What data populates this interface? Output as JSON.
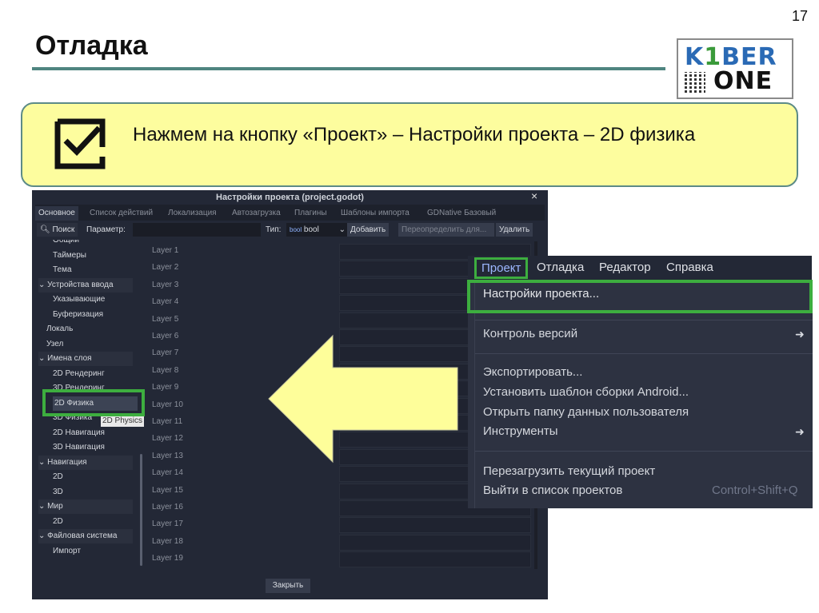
{
  "slide": {
    "title": "Отладка",
    "page_number": "17",
    "logo": {
      "line1_a": "K",
      "line1_b": "1",
      "line1_c": "BER",
      "line2": "ONE"
    },
    "instruction": "Нажмем на кнопку «Проект» – Настройки проекта – 2D физика"
  },
  "dialog": {
    "title": "Настройки проекта (project.godot)",
    "close_glyph": "×",
    "tabs": [
      "Основное",
      "Список действий",
      "Локализация",
      "Автозагрузка",
      "Плагины",
      "Шаблоны импорта",
      "GDNative Базовый"
    ],
    "toolbar": {
      "search": "Поиск",
      "param_label": "Параметр:",
      "type_label": "Тип:",
      "type_value": "bool",
      "add": "Добавить",
      "override": "Переопределить для...",
      "delete": "Удалить"
    },
    "tree": [
      {
        "label": "Общий",
        "indent": 1
      },
      {
        "label": "Таймеры",
        "indent": 1
      },
      {
        "label": "Тема",
        "indent": 1
      },
      {
        "label": "Устройства ввода",
        "indent": 0,
        "category": true
      },
      {
        "label": "Указывающие",
        "indent": 1
      },
      {
        "label": "Буферизация",
        "indent": 1
      },
      {
        "label": "Локаль",
        "indent": 0
      },
      {
        "label": "Узел",
        "indent": 0
      },
      {
        "label": "Имена слоя",
        "indent": 0,
        "category": true
      },
      {
        "label": "2D Рендеринг",
        "indent": 1
      },
      {
        "label": "3D Рендеринг",
        "indent": 1
      },
      {
        "label": "2D Физика",
        "indent": 1,
        "selected": true
      },
      {
        "label": "3D Физика",
        "indent": 1
      },
      {
        "label": "2D Навигация",
        "indent": 1
      },
      {
        "label": "3D Навигация",
        "indent": 1
      },
      {
        "label": "Навигация",
        "indent": 0,
        "category": true
      },
      {
        "label": "2D",
        "indent": 1
      },
      {
        "label": "3D",
        "indent": 1
      },
      {
        "label": "Мир",
        "indent": 0,
        "category": true
      },
      {
        "label": "2D",
        "indent": 1
      },
      {
        "label": "Файловая система",
        "indent": 0,
        "category": true
      },
      {
        "label": "Импорт",
        "indent": 1
      }
    ],
    "tooltip": "2D Physics",
    "layers": [
      "Layer 1",
      "Layer 2",
      "Layer 3",
      "Layer 4",
      "Layer 5",
      "Layer 6",
      "Layer 7",
      "Layer 8",
      "Layer 9",
      "Layer 10",
      "Layer 11",
      "Layer 12",
      "Layer 13",
      "Layer 14",
      "Layer 15",
      "Layer 16",
      "Layer 17",
      "Layer 18",
      "Layer 19"
    ],
    "close_button": "Закрыть"
  },
  "menu": {
    "bar": [
      "Проект",
      "Отладка",
      "Редактор",
      "Справка"
    ],
    "items": [
      {
        "label": "Настройки проекта...",
        "highlighted": true
      },
      {
        "label": "Контроль версий",
        "submenu": true
      },
      {
        "label": "Экспортировать..."
      },
      {
        "label": "Установить шаблон сборки Android..."
      },
      {
        "label": "Открыть папку данных пользователя"
      },
      {
        "label": "Инструменты",
        "submenu": true
      },
      {
        "label": "Перезагрузить текущий проект"
      },
      {
        "label": "Выйти в список проектов",
        "shortcut": "Control+Shift+Q"
      }
    ]
  },
  "colors": {
    "highlight_green": "#3dae3f",
    "arrow_yellow": "#fefe9a",
    "note_bg": "#fdfd9e",
    "godot_bg": "#232836",
    "logo_blue": "#2a6ab5",
    "logo_green": "#3a9a3a"
  }
}
